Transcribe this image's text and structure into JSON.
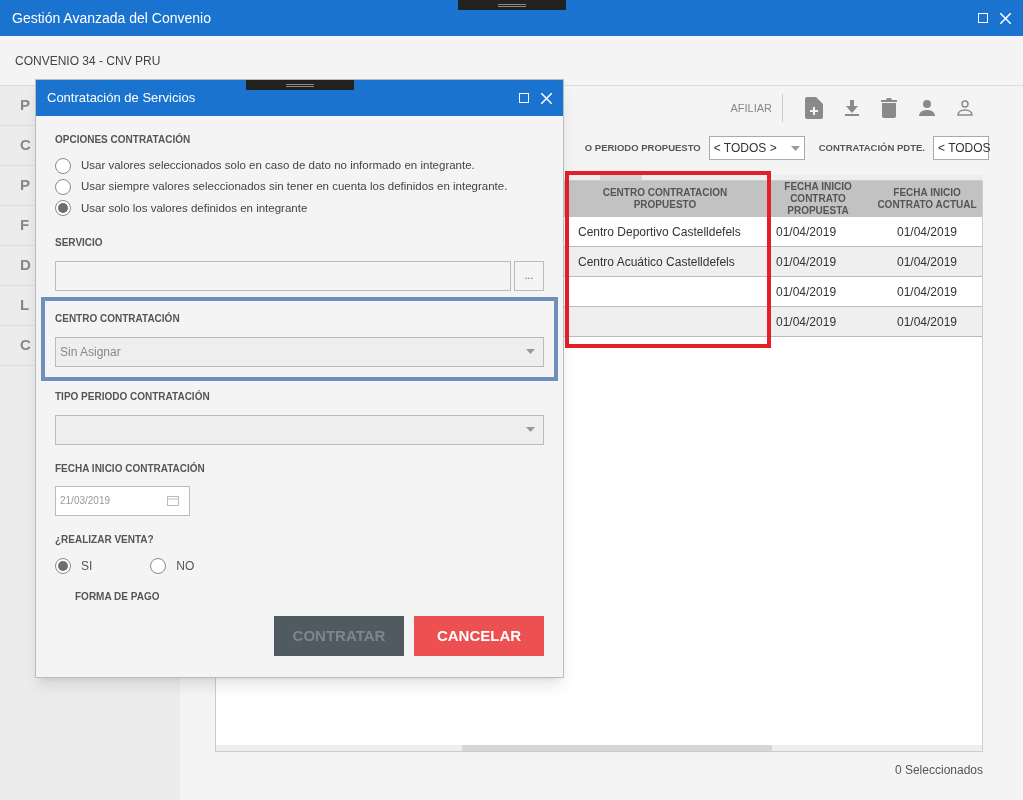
{
  "window": {
    "title": "Gestión Avanzada del Convenio"
  },
  "header": {
    "title": "CONVENIO 34 - CNV PRU"
  },
  "sidebar": {
    "items": [
      {
        "label": "P"
      },
      {
        "label": "C"
      },
      {
        "label": "P"
      },
      {
        "label": "F"
      },
      {
        "label": "D"
      },
      {
        "label": "L"
      },
      {
        "label": "C"
      }
    ]
  },
  "toolbar": {
    "label": "AFILIAR",
    "buttons": [
      {
        "kind": "add-document"
      },
      {
        "kind": "download"
      },
      {
        "kind": "delete"
      },
      {
        "kind": "person"
      },
      {
        "kind": "person-outline"
      }
    ]
  },
  "filters": [
    {
      "label": "O PERIODO PROPUESTO",
      "value": "< TODOS >"
    },
    {
      "label": "CONTRATACIÓN PDTE.",
      "value": "< TODOS"
    }
  ],
  "table": {
    "columns": [
      "CENTRO CONTRATACION PROPUESTO",
      "FECHA INICIO CONTRATO PROPUESTA",
      "FECHA INICIO CONTRATO ACTUAL"
    ],
    "rows": [
      {
        "centro": "Centro Deportivo Castelldefels",
        "fecha_propuesta": "01/04/2019",
        "fecha_actual": "01/04/2019"
      },
      {
        "centro": "Centro Acuático Castelldefels",
        "fecha_propuesta": "01/04/2019",
        "fecha_actual": "01/04/2019"
      },
      {
        "fecha_propuesta": "01/04/2019",
        "fecha_actual": "01/04/2019"
      },
      {
        "fecha_propuesta": "01/04/2019",
        "fecha_actual": "01/04/2019"
      }
    ]
  },
  "status_bar": "0 Seleccionados",
  "dialog": {
    "title": "Contratación de Servicios",
    "options": {
      "label": "OPCIONES CONTRATACIÓN",
      "items": [
        {
          "label": "Usar valores seleccionados solo en caso de dato no informado en integrante.",
          "selected": false
        },
        {
          "label": "Usar siempre valores seleccionados sin tener en cuenta los definidos en integrante.",
          "selected": false
        },
        {
          "label": "Usar solo los valores definidos en integrante",
          "selected": true
        }
      ]
    },
    "servicio": {
      "label": "SERVICIO",
      "button": "..."
    },
    "centro": {
      "label": "CENTRO CONTRATACIÓN",
      "value": "Sin Asignar"
    },
    "tipo_periodo": {
      "label": "TIPO PERIODO CONTRATACIÓN"
    },
    "fecha": {
      "label": "FECHA INICIO CONTRATACIÓN",
      "value": "21/03/2019"
    },
    "venta": {
      "label": "¿REALIZAR VENTA?",
      "items": [
        {
          "label": "SI",
          "selected": true
        },
        {
          "label": "NO",
          "selected": false
        }
      ]
    },
    "forma_pago": {
      "label": "FORMA DE PAGO"
    },
    "buttons": [
      {
        "label": "CONTRATAR",
        "kind": "primary",
        "disabled": true
      },
      {
        "label": "CANCELAR",
        "kind": "cancel",
        "disabled": false
      }
    ]
  }
}
